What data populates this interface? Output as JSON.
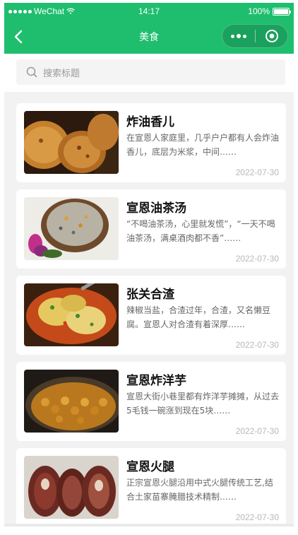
{
  "status": {
    "carrier": "WeChat",
    "time": "14:17",
    "battery": "100%",
    "battery_level": 1.0
  },
  "nav": {
    "title": "美食"
  },
  "search": {
    "placeholder": "搜索标题"
  },
  "articles": [
    {
      "title": "炸油香儿",
      "desc": "在宣恩人家庭里，几乎户户都有人会炸油香儿，底层为米浆，中间……",
      "date": "2022-07-30"
    },
    {
      "title": "宣恩油茶汤",
      "desc": "“不喝油茶汤，心里就发慌”，“一天不喝油茶汤，满桌酒肉都不香”……",
      "date": "2022-07-30"
    },
    {
      "title": "张关合渣",
      "desc": "辣椒当盐，合渣过年，合渣，又名懒豆腐。宣恩人对合渣有着深厚……",
      "date": "2022-07-30"
    },
    {
      "title": "宣恩炸洋芋",
      "desc": "宣恩大街小巷里都有炸洋芋摊摊，从过去5毛钱一碗涨到现在5块……",
      "date": "2022-07-30"
    },
    {
      "title": "宣恩火腿",
      "desc": "正宗宣恩火腿沿用中式火腿传统工艺,结合土家苗寨腌腊技术精制……",
      "date": "2022-07-30"
    }
  ],
  "colors": {
    "brand": "#1fbe6e",
    "background": "#f2f2f2",
    "date": "#b8b8b8"
  }
}
